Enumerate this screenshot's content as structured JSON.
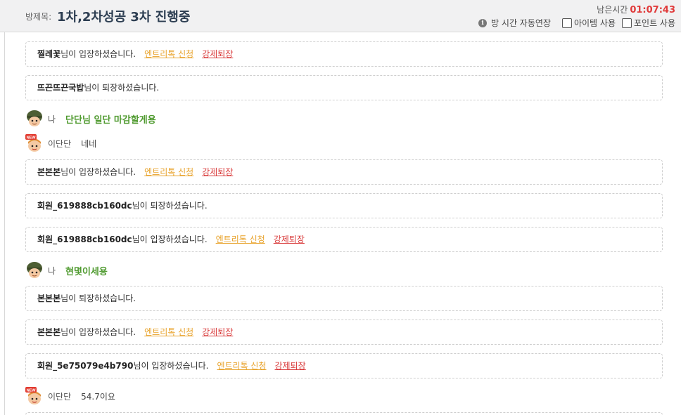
{
  "header": {
    "room_label": "방제목:",
    "room_title": "1차,2차성공 3차 진행중",
    "timer_label": "남은시간",
    "timer_value": "01:07:43",
    "auto_extend": "방 시간 자동연장",
    "item_label": "아이템 사용",
    "point_label": "포인트 사용"
  },
  "actions": {
    "entry_ticket": "엔트리톡 신청",
    "kick": "강제퇴장"
  },
  "messages": [
    {
      "kind": "log",
      "nick": "찔레꽃",
      "text": "님이 입장하셨습니다.",
      "actions": true
    },
    {
      "kind": "log",
      "nick": "뜨끈뜨끈국밥",
      "text": "님이 퇴장하셨습니다.",
      "actions": false
    },
    {
      "kind": "chat",
      "who": "나",
      "text": "단단님 일단 마감할게용",
      "me": true
    },
    {
      "kind": "chat",
      "who": "이단단",
      "text": "네네",
      "me": false
    },
    {
      "kind": "log",
      "nick": "본본본",
      "text": "님이 입장하셨습니다.",
      "actions": true
    },
    {
      "kind": "log",
      "nick": "회원_619888cb160dc",
      "text": "님이 퇴장하셨습니다.",
      "actions": false
    },
    {
      "kind": "log",
      "nick": "회원_619888cb160dc",
      "text": "님이 입장하셨습니다.",
      "actions": true
    },
    {
      "kind": "chat",
      "who": "나",
      "text": "현몇이세용",
      "me": true
    },
    {
      "kind": "log",
      "nick": "본본본",
      "text": "님이 퇴장하셨습니다.",
      "actions": false
    },
    {
      "kind": "log",
      "nick": "본본본",
      "text": "님이 입장하셨습니다.",
      "actions": true
    },
    {
      "kind": "log",
      "nick": "회원_5e75079e4b790",
      "text": "님이 입장하셨습니다.",
      "actions": true
    },
    {
      "kind": "chat",
      "who": "이단단",
      "text": "54.7이요",
      "me": false
    }
  ],
  "icons": {
    "info": "info-icon",
    "my_avatar": "soldier-avatar-icon",
    "other_avatar": "new-badge-avatar-icon"
  },
  "colors": {
    "title": "#2d3e52",
    "timer": "#e03a3a",
    "my_message": "#4f9a2f",
    "entry_link": "#e8a32c",
    "kick_link": "#d93a3a"
  }
}
